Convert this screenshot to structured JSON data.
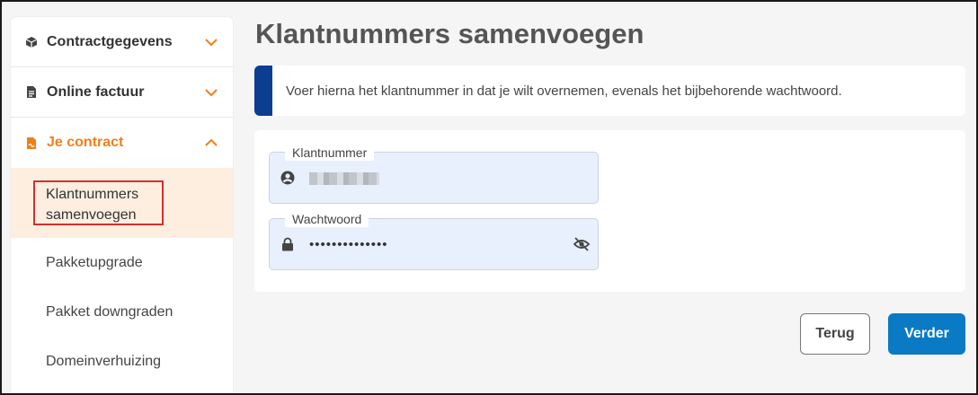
{
  "sidebar": {
    "sections": [
      {
        "label": "Contractgegevens",
        "icon": "box-icon",
        "expanded": false
      },
      {
        "label": "Online factuur",
        "icon": "document-icon",
        "expanded": false
      },
      {
        "label": "Je contract",
        "icon": "contract-file-icon",
        "expanded": true
      }
    ],
    "items": [
      {
        "label": "Klantnummers samenvoegen",
        "line1": "Klantnummers",
        "line2": "samenvoegen",
        "current": true
      },
      {
        "label": "Pakketupgrade"
      },
      {
        "label": "Pakket downgraden"
      },
      {
        "label": "Domeinverhuizing"
      }
    ]
  },
  "main": {
    "title": "Klantnummers samenvoegen",
    "info": "Voer hierna het klantnummer in dat je wilt overnemen, evenals het bijbehorende wachtwoord.",
    "fields": {
      "customer_number": {
        "label": "Klantnummer",
        "value_redacted": true
      },
      "password": {
        "label": "Wachtwoord",
        "value": "••••••••••••••"
      }
    },
    "buttons": {
      "back": "Terug",
      "next": "Verder"
    }
  },
  "colors": {
    "accent": "#f07f1a",
    "primary_button": "#0a7ac4",
    "info_bar": "#0b3d91",
    "field_bg": "#e8f0fe",
    "highlight_box": "#d32f2f"
  }
}
